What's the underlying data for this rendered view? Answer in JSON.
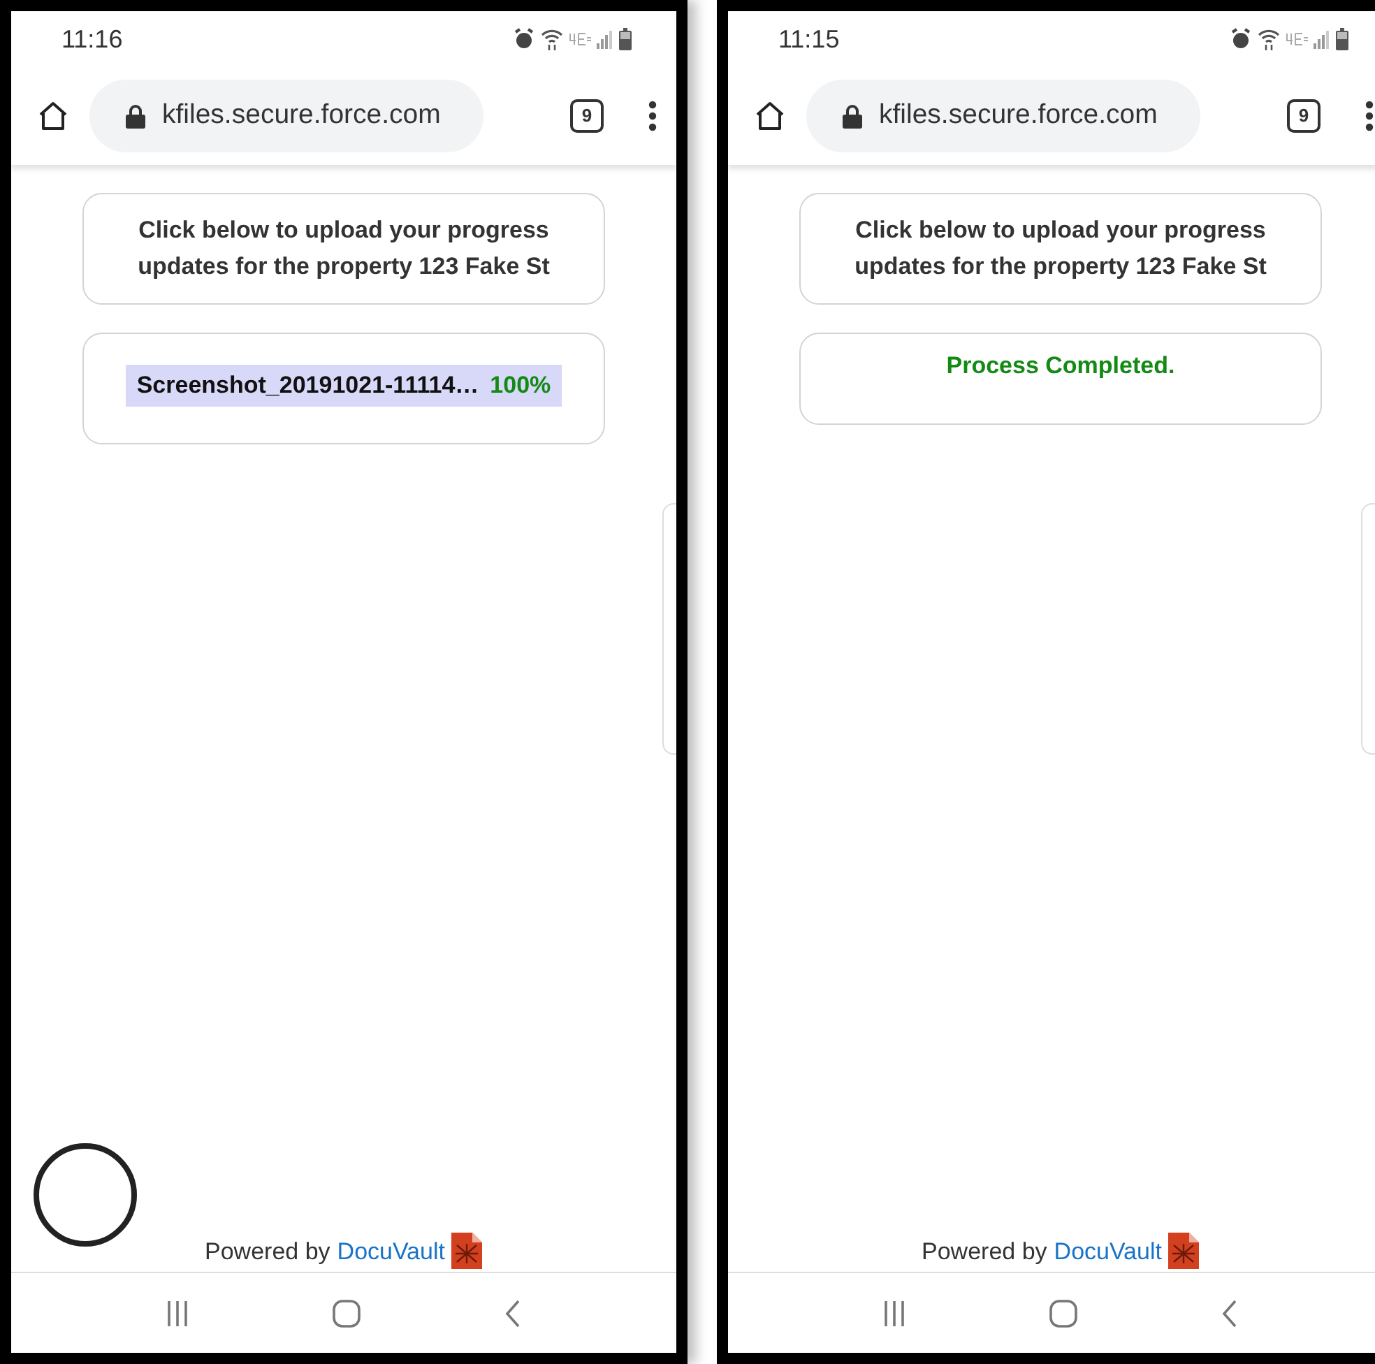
{
  "screens": [
    {
      "status_bar": {
        "time": "11:16"
      },
      "address_bar": {
        "url": "kfiles.secure.force.com",
        "tab_count": "9"
      },
      "cards": [
        {
          "kind": "message",
          "text": "Click below to upload your progress updates for the property 123 Fake St"
        },
        {
          "kind": "upload",
          "file_name": "Screenshot_20191021-11114…",
          "percent": "100%"
        }
      ],
      "floating_button": true,
      "footer": {
        "prefix": "Powered by",
        "link": "DocuVault"
      }
    },
    {
      "status_bar": {
        "time": "11:15"
      },
      "address_bar": {
        "url": "kfiles.secure.force.com",
        "tab_count": "9"
      },
      "cards": [
        {
          "kind": "message",
          "text": "Click below to upload your progress updates for the property 123 Fake St"
        },
        {
          "kind": "status",
          "text": "Process Completed."
        }
      ],
      "footer": {
        "prefix": "Powered by",
        "link": "DocuVault"
      }
    }
  ]
}
